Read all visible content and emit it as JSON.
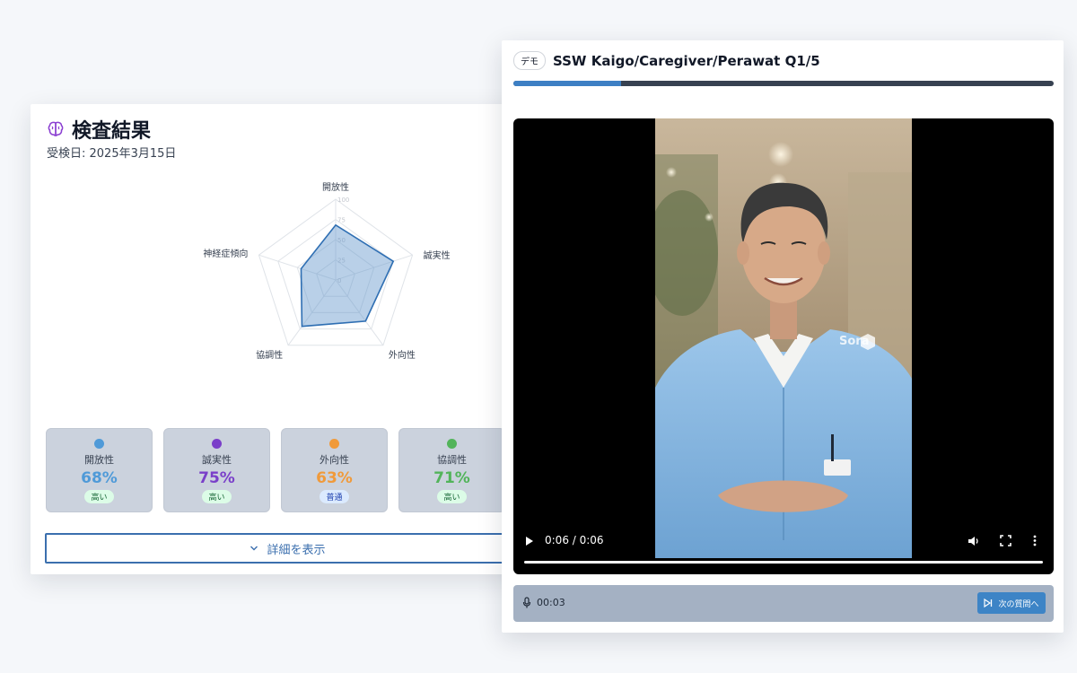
{
  "result": {
    "title": "検査結果",
    "date": "受検日: 2025年3月15日",
    "radar": {
      "axes": [
        "開放性",
        "誠実性",
        "外向性",
        "協調性",
        "神経症傾向"
      ],
      "values": [
        68,
        75,
        63,
        71,
        45
      ],
      "ticks": [
        "100",
        "75",
        "50",
        "25",
        "0"
      ],
      "max": 100
    },
    "traits": [
      {
        "name": "開放性",
        "percent": "68%",
        "level": "高い",
        "color": "#4f9ad8"
      },
      {
        "name": "誠実性",
        "percent": "75%",
        "level": "高い",
        "color": "#7a3fc9"
      },
      {
        "name": "外向性",
        "percent": "63%",
        "level": "普通",
        "color": "#f09a3a"
      },
      {
        "name": "協調性",
        "percent": "71%",
        "level": "高い",
        "color": "#52b45a"
      }
    ],
    "detail_button": "詳細を表示"
  },
  "video": {
    "badge": "デモ",
    "title": "SSW Kaigo/Caregiver/Perawat Q1/5",
    "question_progress": 0.2,
    "time_display": "0:06 / 0:06",
    "recording_time": "00:03",
    "next_button": "次の質問へ",
    "watermark": "Sora"
  }
}
